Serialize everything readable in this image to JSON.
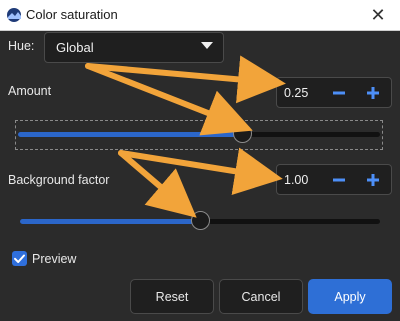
{
  "window": {
    "title": "Color saturation",
    "close_icon": "close-icon"
  },
  "hue": {
    "label": "Hue:",
    "value": "Global"
  },
  "amount": {
    "label": "Amount",
    "value": "0.25",
    "slider_fraction": 0.62
  },
  "background_factor": {
    "label": "Background factor",
    "value": "1.00",
    "slider_fraction": 0.5
  },
  "preview": {
    "label": "Preview",
    "checked": true
  },
  "buttons": {
    "reset": "Reset",
    "cancel": "Cancel",
    "apply": "Apply"
  },
  "colors": {
    "accent": "#2e6fd6",
    "annotation": "#f2a43a",
    "background": "#2b2b2b"
  }
}
